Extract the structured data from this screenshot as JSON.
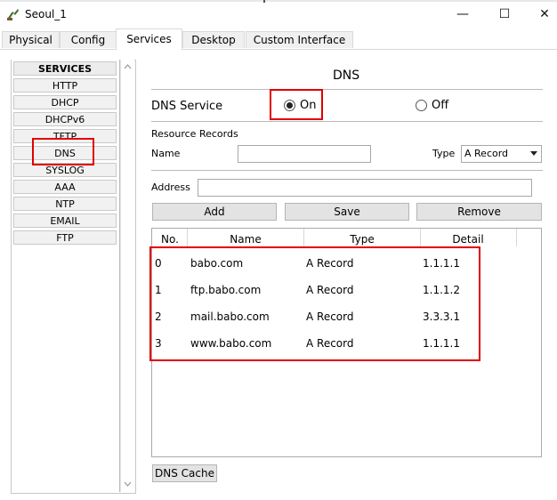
{
  "window": {
    "title": "Seoul_1",
    "minimize": "—",
    "maximize": "☐",
    "close": "✕"
  },
  "tabs": [
    "Physical",
    "Config",
    "Services",
    "Desktop",
    "Custom Interface"
  ],
  "services": {
    "header": "SERVICES",
    "items": [
      "HTTP",
      "DHCP",
      "DHCPv6",
      "TFTP",
      "DNS",
      "SYSLOG",
      "AAA",
      "NTP",
      "EMAIL",
      "FTP"
    ],
    "selected": "DNS"
  },
  "dns": {
    "title": "DNS",
    "service_label": "DNS Service",
    "on_label": "On",
    "off_label": "Off",
    "resource_records_label": "Resource Records",
    "name_label": "Name",
    "name_value": "",
    "type_label": "Type",
    "type_value": "A Record",
    "address_label": "Address",
    "address_value": "",
    "add_button": "Add",
    "save_button": "Save",
    "remove_button": "Remove",
    "columns": [
      "No.",
      "Name",
      "Type",
      "Detail"
    ],
    "records": [
      {
        "no": "0",
        "name": "babo.com",
        "type": "A Record",
        "detail": "1.1.1.1"
      },
      {
        "no": "1",
        "name": "ftp.babo.com",
        "type": "A Record",
        "detail": "1.1.1.2"
      },
      {
        "no": "2",
        "name": "mail.babo.com",
        "type": "A Record",
        "detail": "3.3.3.1"
      },
      {
        "no": "3",
        "name": "www.babo.com",
        "type": "A Record",
        "detail": "1.1.1.1"
      }
    ],
    "cache_button": "DNS Cache"
  },
  "colors": {
    "highlight": "#e10000"
  }
}
